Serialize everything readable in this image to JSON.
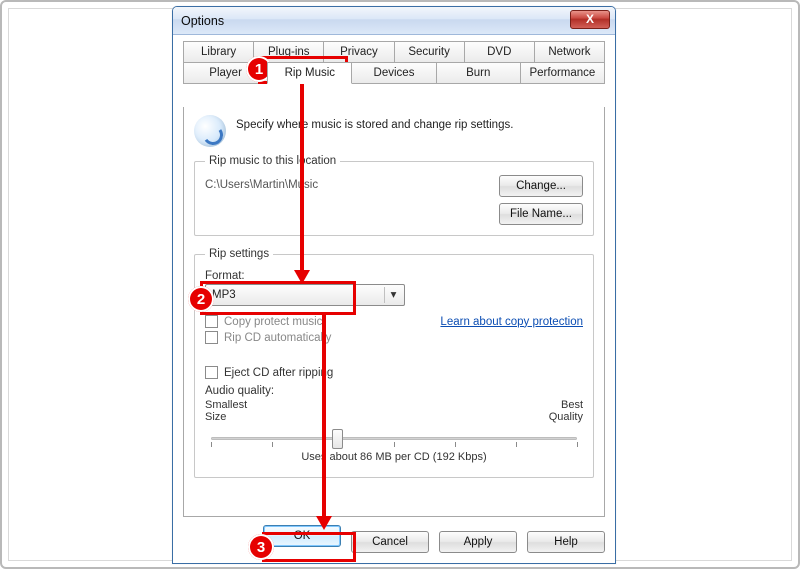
{
  "window": {
    "title": "Options",
    "close_glyph": "X"
  },
  "tabs_row1": [
    "Library",
    "Plug-ins",
    "Privacy",
    "Security",
    "DVD",
    "Network"
  ],
  "tabs_row2": [
    "Player",
    "Rip Music",
    "Devices",
    "Burn",
    "Performance"
  ],
  "active_tab": "Rip Music",
  "intro": "Specify where music is stored and change rip settings.",
  "rip_location": {
    "legend": "Rip music to this location",
    "path": "C:\\Users\\Martin\\Music",
    "change_btn": "Change...",
    "filename_btn": "File Name..."
  },
  "rip_settings": {
    "legend": "Rip settings",
    "format_label": "Format:",
    "format_value": "MP3",
    "copy_protect_label": "Copy protect music",
    "copy_protect_checked": false,
    "learn_link": "Learn about copy protection",
    "rip_auto_label": "Rip CD automatically",
    "rip_auto_checked": false,
    "eject_label": "Eject CD after ripping",
    "eject_checked": false,
    "quality_label": "Audio quality:",
    "quality_left": "Smallest\nSize",
    "quality_right": "Best\nQuality",
    "usage_text": "Uses about 86 MB per CD (192 Kbps)"
  },
  "buttons": {
    "ok": "OK",
    "cancel": "Cancel",
    "apply": "Apply",
    "help": "Help"
  },
  "annotations": {
    "b1": "1",
    "b2": "2",
    "b3": "3"
  }
}
